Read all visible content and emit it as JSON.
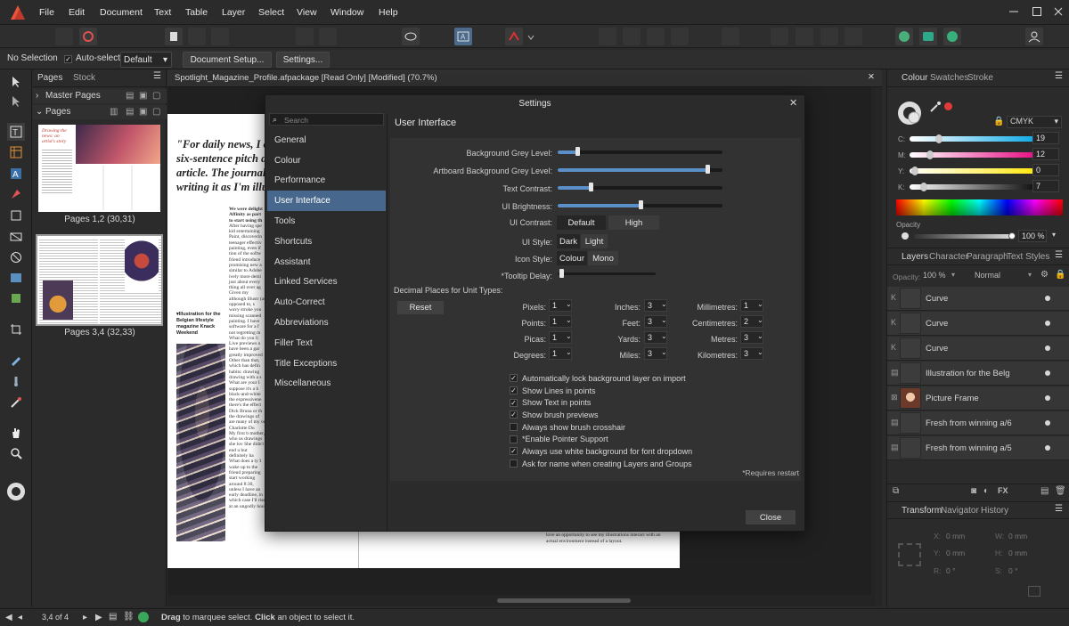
{
  "menubar": {
    "items": [
      "File",
      "Edit",
      "Document",
      "Text",
      "Table",
      "Layer",
      "Select",
      "View",
      "Window",
      "Help"
    ]
  },
  "context": {
    "selection": "No Selection",
    "autoselect_label": "Auto-select:",
    "autoselect_value": "Default",
    "document_setup": "Document Setup...",
    "settings": "Settings..."
  },
  "pages": {
    "tabs": [
      "Pages",
      "Stock"
    ],
    "master_pages": "Master Pages",
    "pages_header": "Pages",
    "spreads": [
      {
        "label": "Pages 1,2 (30,31)"
      },
      {
        "label": "Pages 3,4 (32,33)"
      }
    ],
    "thumb_text_1": "Drawing the news: an artist's story",
    "thumb_text_2": "What's in the tin?"
  },
  "document": {
    "tab_title": "Spotlight_Magazine_Profile.afpackage [Read Only] [Modified] (70.7%)",
    "quote": "\"For daily news, I of six-sentence pitch de article. The journali writing it as I'm illu",
    "caption": "▾Illustration for the Belgian lifestyle magazine Knack Weekend",
    "body_snips": [
      "We were delight Affinity as part to start using th",
      "After having spe kid entertaining Paint, discoverin teenager effectiv painting, even if tion of the softw friend introduce promising new a similar to Adobe ively more demi just about every thing all over ag",
      "Given my although illustr (as opposed to, s wavy stroke you missing scanned painting. I have software for a f not regretting m",
      "What do you li Live previews o have been a gar greatly improved Other than that, which has defin habits: drawing drawing with a s",
      "What are your I suppose it's a b black-and-white the expressivene there's the effect Dick Bruna or th the drawings of are many of my or Charlotte Du",
      "My first b mother, who us drawings she lov She didn't end u but definitely ha",
      "What does a ty I wake up to the friend preparing start working around 8:30, unless I have an early deadline, in which case I'll rise at an ungodly hour",
      "love an opportunity to see my illustrations interact with an actual environment instead of a layout."
    ]
  },
  "dialog": {
    "title": "Settings",
    "search_placeholder": "Search",
    "categories": [
      "General",
      "Colour",
      "Performance",
      "User Interface",
      "Tools",
      "Shortcuts",
      "Assistant",
      "Linked Services",
      "Auto-Correct",
      "Abbreviations",
      "Filler Text",
      "Title Exceptions",
      "Miscellaneous"
    ],
    "selected_category": "User Interface",
    "section_title": "User Interface",
    "sliders": [
      {
        "label": "Background Grey Level:",
        "value": 0.12
      },
      {
        "label": "Artboard Background Grey Level:",
        "value": 0.91
      },
      {
        "label": "Text Contrast:",
        "value": 0.2
      },
      {
        "label": "UI Brightness:",
        "value": 0.5
      }
    ],
    "ui_contrast": {
      "label": "UI Contrast:",
      "options": [
        "Default",
        "High"
      ],
      "selected": "Default"
    },
    "ui_style": {
      "label": "UI Style:",
      "options": [
        "Dark",
        "Light"
      ],
      "selected": "Dark"
    },
    "icon_style": {
      "label": "Icon Style:",
      "options": [
        "Colour",
        "Mono"
      ],
      "selected": "Colour"
    },
    "tooltip_delay": {
      "label": "*Tooltip Delay:",
      "value": 0.02
    },
    "decimal_title": "Decimal Places for Unit Types:",
    "reset": "Reset",
    "units": [
      {
        "label": "Pixels:",
        "value": "1"
      },
      {
        "label": "Points:",
        "value": "1"
      },
      {
        "label": "Picas:",
        "value": "1"
      },
      {
        "label": "Degrees:",
        "value": "1"
      },
      {
        "label": "Inches:",
        "value": "3"
      },
      {
        "label": "Feet:",
        "value": "3"
      },
      {
        "label": "Yards:",
        "value": "3"
      },
      {
        "label": "Miles:",
        "value": "3"
      },
      {
        "label": "Millimetres:",
        "value": "1"
      },
      {
        "label": "Centimetres:",
        "value": "2"
      },
      {
        "label": "Metres:",
        "value": "3"
      },
      {
        "label": "Kilometres:",
        "value": "3"
      }
    ],
    "checks": [
      {
        "label": "Automatically lock background layer on import",
        "checked": true
      },
      {
        "label": "Show Lines in points",
        "checked": true
      },
      {
        "label": "Show Text in points",
        "checked": true
      },
      {
        "label": "Show brush previews",
        "checked": true
      },
      {
        "label": "Always show brush crosshair",
        "checked": false
      },
      {
        "label": "*Enable Pointer Support",
        "checked": false
      },
      {
        "label": "Always use white background for font dropdown",
        "checked": true
      },
      {
        "label": "Ask for name when creating Layers and Groups",
        "checked": false
      }
    ],
    "restart_note": "*Requires restart",
    "close": "Close"
  },
  "colour": {
    "tabs": [
      "Colour",
      "Swatches",
      "Stroke"
    ],
    "model": "CMYK",
    "channels": [
      {
        "label": "C:",
        "value": "19",
        "pos": 0.19
      },
      {
        "label": "M:",
        "value": "12",
        "pos": 0.12
      },
      {
        "label": "Y:",
        "value": "0",
        "pos": 0
      },
      {
        "label": "K:",
        "value": "7",
        "pos": 0.07
      }
    ],
    "opacity_label": "Opacity",
    "opacity_value": "100 %"
  },
  "layers": {
    "tabs": [
      "Layers",
      "Character",
      "Paragraph",
      "Text Styles"
    ],
    "opacity_label": "Opacity:",
    "opacity_value": "100 %",
    "blend": "Normal",
    "rows": [
      "Curve",
      "Curve",
      "Curve",
      "Illustration for the Belg",
      "Picture Frame",
      "Fresh from winning a/6",
      "Fresh from winning a/5"
    ]
  },
  "transform": {
    "tabs": [
      "Transform",
      "Navigator",
      "History"
    ],
    "x_label": "X:",
    "x": "0 mm",
    "y_label": "Y:",
    "y": "0 mm",
    "w_label": "W:",
    "w": "0 mm",
    "h_label": "H:",
    "h": "0 mm",
    "r_label": "R:",
    "r": "0 °",
    "s_label": "S:",
    "s": "0 °"
  },
  "status": {
    "page": "3,4 of 4",
    "hint_drag": "Drag",
    "hint_mid": " to marquee select. ",
    "hint_click": "Click",
    "hint_end": " an object to select it."
  },
  "colors": {
    "accent": "#47688c",
    "slider_fill": "#5b8fc8",
    "swatch_primary": "#e23a3a"
  }
}
